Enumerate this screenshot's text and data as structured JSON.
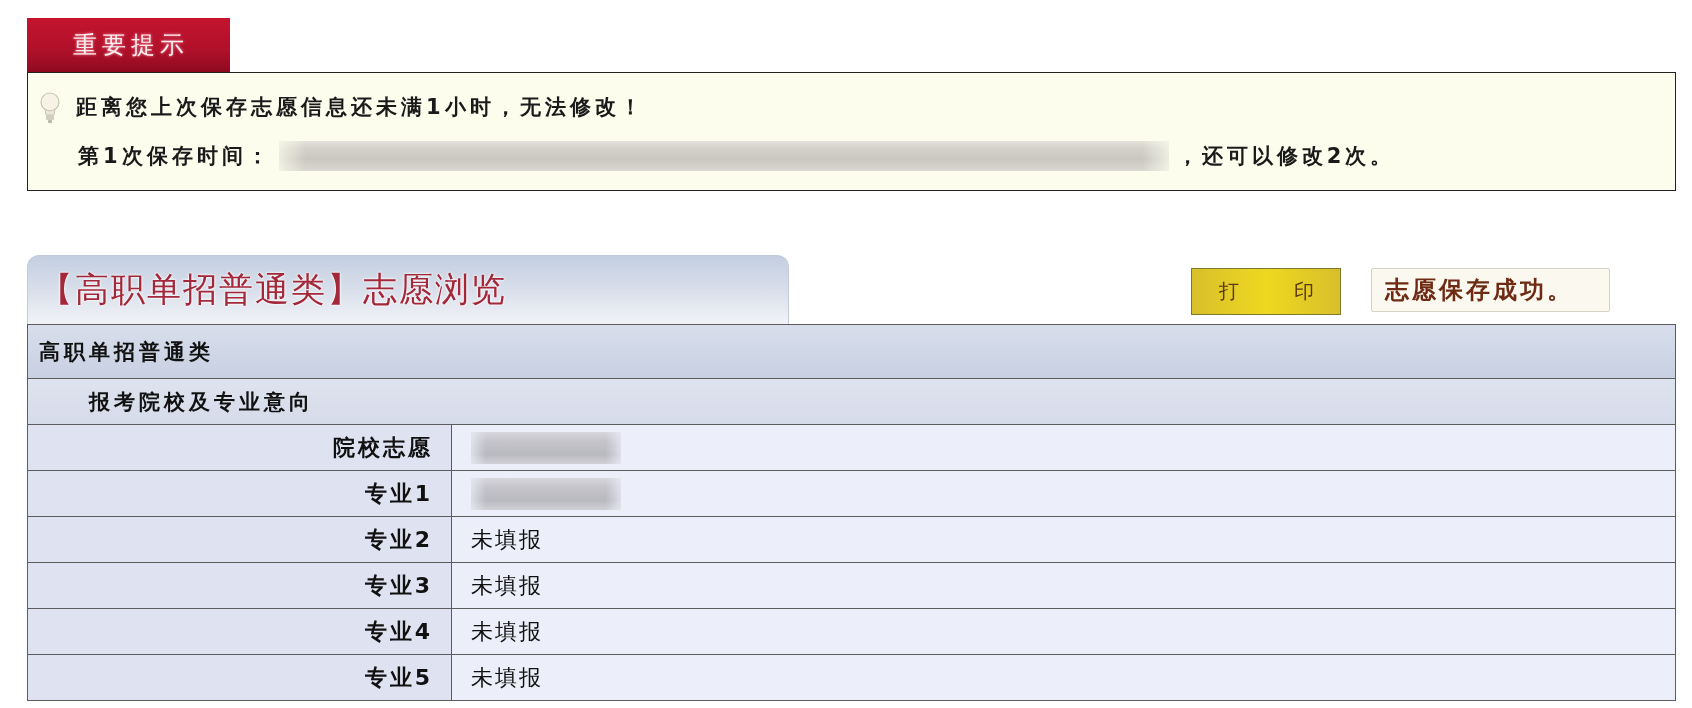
{
  "notice": {
    "tab_label": "重要提示",
    "message": "距离您上次保存志愿信息还未满1小时，无法修改！",
    "save_time_label": "第1次保存时间：",
    "remaining_note": "，还可以修改2次。"
  },
  "panel": {
    "title": "【高职单招普通类】志愿浏览",
    "print_button": "打　　印",
    "status_message": "志愿保存成功。"
  },
  "table": {
    "category": "高职单招普通类",
    "section": "报考院校及专业意向",
    "rows": [
      {
        "label": "院校志愿",
        "kind": "redacted"
      },
      {
        "label": "专业1",
        "kind": "redacted"
      },
      {
        "label": "专业2",
        "kind": "text",
        "value": "未填报"
      },
      {
        "label": "专业3",
        "kind": "text",
        "value": "未填报"
      },
      {
        "label": "专业4",
        "kind": "text",
        "value": "未填报"
      },
      {
        "label": "专业5",
        "kind": "text",
        "value": "未填报"
      }
    ]
  }
}
